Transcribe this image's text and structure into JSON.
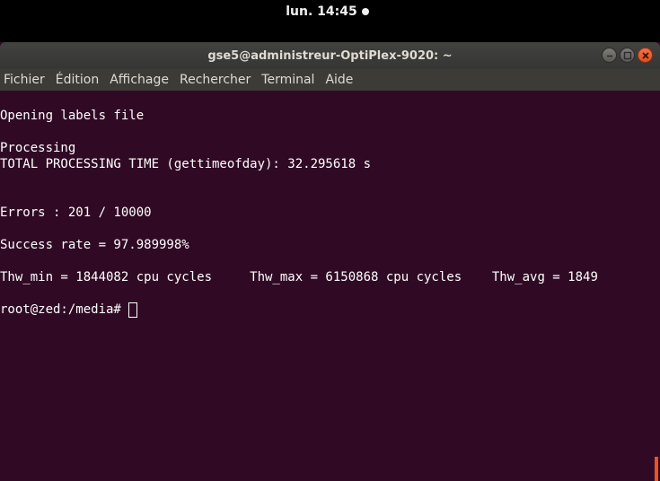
{
  "topbar": {
    "clock": "lun. 14:45"
  },
  "window": {
    "title": "gse5@administreur-OptiPlex-9020: ~",
    "menu": [
      "Fichier",
      "Édition",
      "Affichage",
      "Rechercher",
      "Terminal",
      "Aide"
    ]
  },
  "terminal": {
    "lines": [
      "Opening labels file",
      "",
      "Processing",
      "TOTAL PROCESSING TIME (gettimeofday): 32.295618 s",
      "",
      "",
      "Errors : 201 / 10000",
      "",
      "Success rate = 97.989998%",
      "",
      "Thw_min = 1844082 cpu cycles     Thw_max = 6150868 cpu cycles    Thw_avg = 1849",
      ""
    ],
    "prompt": "root@zed:/media#"
  },
  "colors": {
    "terminal_bg": "#300a24",
    "accent": "#e95420"
  }
}
